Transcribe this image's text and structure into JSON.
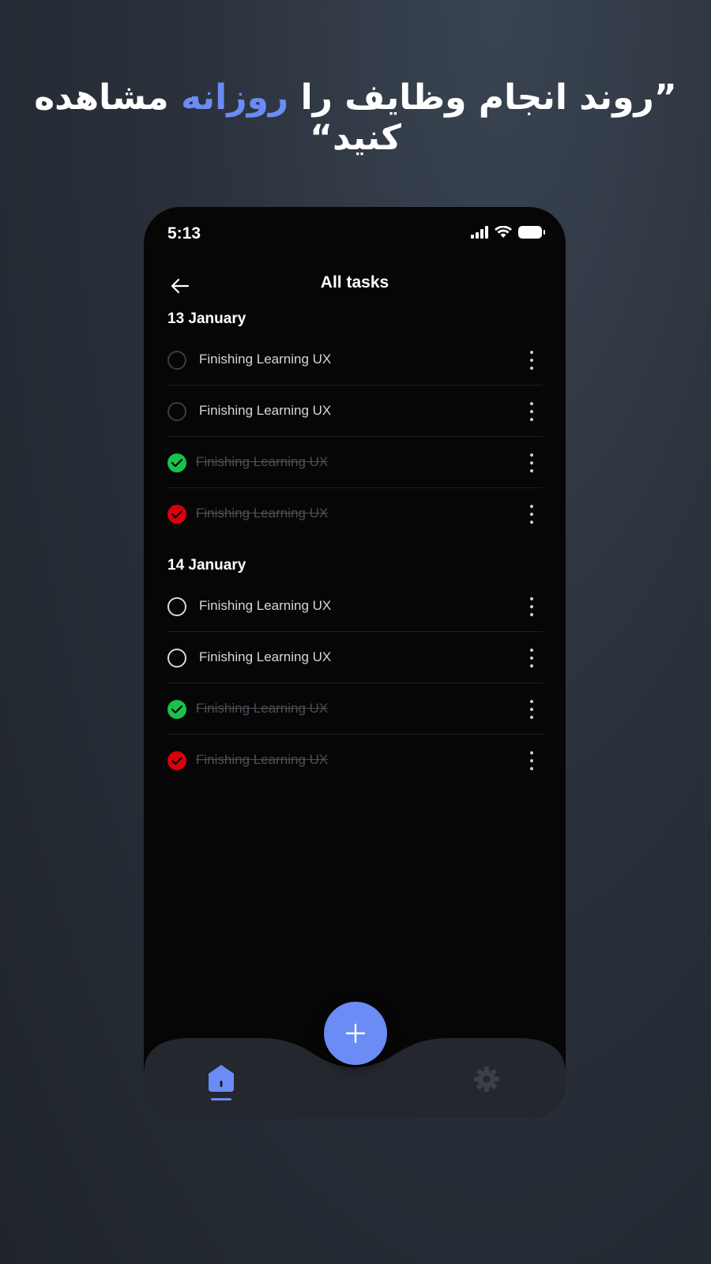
{
  "headline": {
    "open_quote": "”",
    "part1": "روند انجام وظایف را ",
    "highlight": "روزانه",
    "part2": " مشاهده کنید",
    "close_quote": "“"
  },
  "status_bar": {
    "time": "5:13"
  },
  "app_bar": {
    "title": "All tasks",
    "back_icon": "arrow-left-icon"
  },
  "groups": [
    {
      "date": "13 January",
      "tasks": [
        {
          "label": "Finishing Learning UX",
          "state": "open"
        },
        {
          "label": "Finishing Learning UX",
          "state": "open"
        },
        {
          "label": "Finishing Learning UX",
          "state": "done"
        },
        {
          "label": "Finishing Learning UX",
          "state": "failed"
        }
      ]
    },
    {
      "date": "14 January",
      "tasks": [
        {
          "label": "Finishing Learning UX",
          "state": "open"
        },
        {
          "label": "Finishing Learning UX",
          "state": "open"
        },
        {
          "label": "Finishing Learning UX",
          "state": "done"
        },
        {
          "label": "Finishing Learning UX",
          "state": "failed"
        }
      ]
    }
  ],
  "colors": {
    "accent": "#6b8bf5",
    "done": "#18c34a",
    "failed": "#d9000b",
    "background": "#060606",
    "nav_bar": "#24272d"
  },
  "bottom_nav": {
    "fab_icon": "plus-icon",
    "home_icon": "home-icon",
    "settings_icon": "gear-icon"
  }
}
